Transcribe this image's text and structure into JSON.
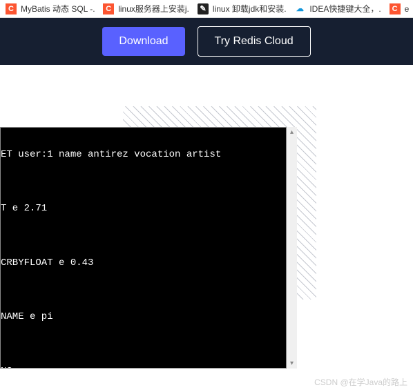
{
  "browser": {
    "tabs": [
      {
        "icon": "csdn-icon",
        "label": "MyBatis 动态 SQL -..."
      },
      {
        "icon": "csdn-icon",
        "label": "linux服务器上安装j..."
      },
      {
        "icon": "dark-icon",
        "label": "linux 卸载jdk和安装..."
      },
      {
        "icon": "idea-icon",
        "label": "IDEA快捷键大全，..."
      },
      {
        "icon": "csdn-icon",
        "label": "e"
      }
    ]
  },
  "navbar": {
    "download_label": "Download",
    "cloud_label": "Try Redis Cloud"
  },
  "terminal": {
    "lines": [
      "ET user:1 name antirez vocation artist",
      "",
      "T e 2.71",
      "",
      "CRBYFLOAT e 0.43",
      "",
      "NAME e pi",
      "",
      "NG"
    ]
  },
  "watermark": "CSDN @在学Java的路上",
  "icons": {
    "csdn_glyph": "C",
    "dark_glyph": "✎",
    "idea_glyph": "☁"
  }
}
